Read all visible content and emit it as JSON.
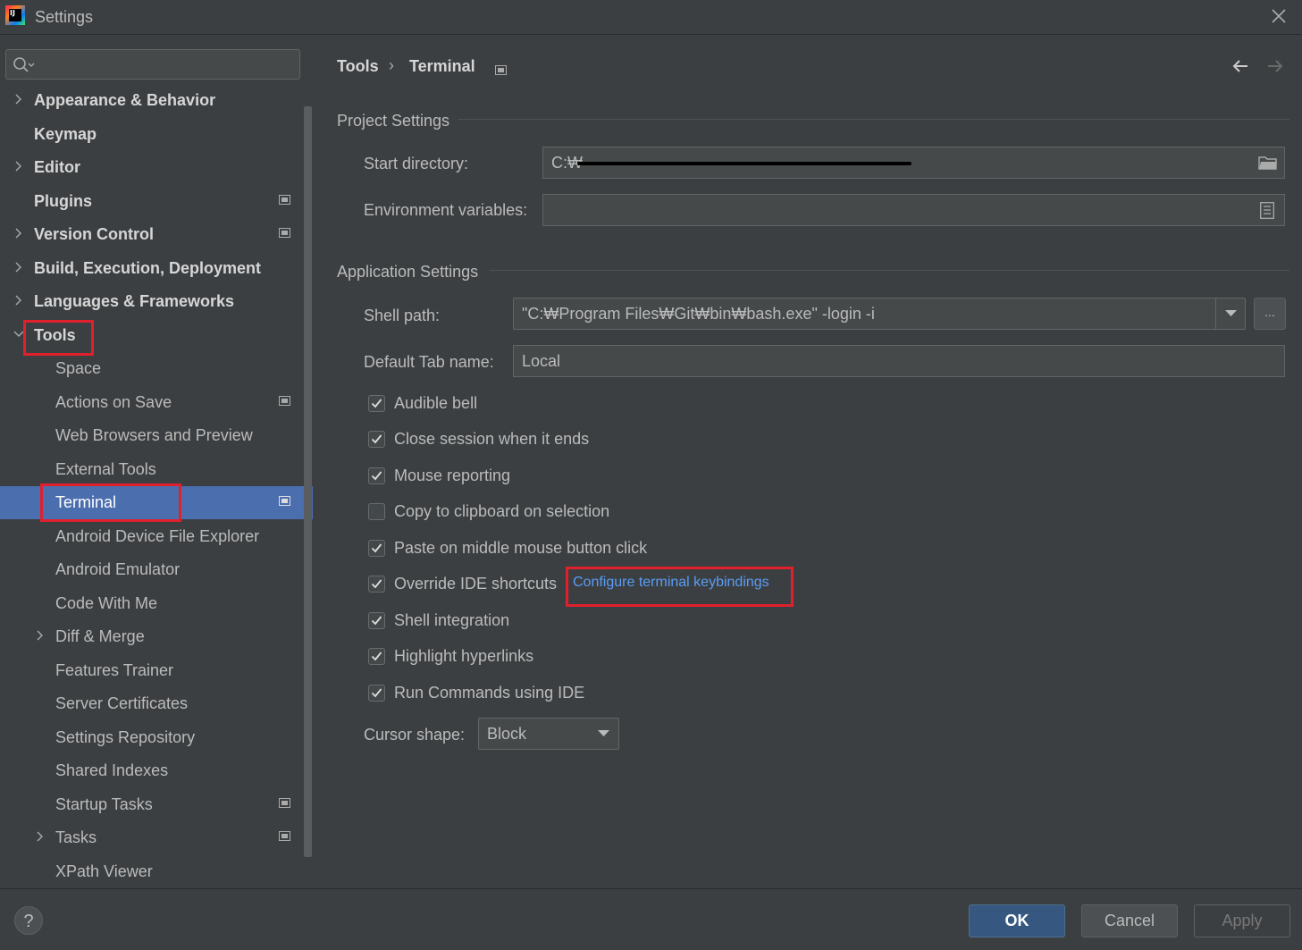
{
  "window": {
    "title": "Settings",
    "logo_text": "IJ"
  },
  "search": {
    "placeholder": ""
  },
  "sidebar": {
    "items": [
      {
        "label": "Appearance & Behavior",
        "level": 0,
        "expandable": true,
        "expanded": false,
        "project_icon": false
      },
      {
        "label": "Keymap",
        "level": 0,
        "expandable": false,
        "project_icon": false
      },
      {
        "label": "Editor",
        "level": 0,
        "expandable": true,
        "expanded": false,
        "project_icon": false
      },
      {
        "label": "Plugins",
        "level": 0,
        "expandable": false,
        "project_icon": true
      },
      {
        "label": "Version Control",
        "level": 0,
        "expandable": true,
        "expanded": false,
        "project_icon": true
      },
      {
        "label": "Build, Execution, Deployment",
        "level": 0,
        "expandable": true,
        "expanded": false,
        "project_icon": false
      },
      {
        "label": "Languages & Frameworks",
        "level": 0,
        "expandable": true,
        "expanded": false,
        "project_icon": false
      },
      {
        "label": "Tools",
        "level": 0,
        "expandable": true,
        "expanded": true,
        "project_icon": false,
        "highlighted": true
      },
      {
        "label": "Space",
        "level": 1,
        "expandable": false,
        "project_icon": false
      },
      {
        "label": "Actions on Save",
        "level": 1,
        "expandable": false,
        "project_icon": true
      },
      {
        "label": "Web Browsers and Preview",
        "level": 1,
        "expandable": false,
        "project_icon": false
      },
      {
        "label": "External Tools",
        "level": 1,
        "expandable": false,
        "project_icon": false
      },
      {
        "label": "Terminal",
        "level": 1,
        "expandable": false,
        "project_icon": true,
        "selected": true,
        "highlighted": true
      },
      {
        "label": "Android Device File Explorer",
        "level": 1,
        "expandable": false,
        "project_icon": false
      },
      {
        "label": "Android Emulator",
        "level": 1,
        "expandable": false,
        "project_icon": false
      },
      {
        "label": "Code With Me",
        "level": 1,
        "expandable": false,
        "project_icon": false
      },
      {
        "label": "Diff & Merge",
        "level": 1,
        "expandable": true,
        "expanded": false,
        "project_icon": false
      },
      {
        "label": "Features Trainer",
        "level": 1,
        "expandable": false,
        "project_icon": false
      },
      {
        "label": "Server Certificates",
        "level": 1,
        "expandable": false,
        "project_icon": false
      },
      {
        "label": "Settings Repository",
        "level": 1,
        "expandable": false,
        "project_icon": false
      },
      {
        "label": "Shared Indexes",
        "level": 1,
        "expandable": false,
        "project_icon": false
      },
      {
        "label": "Startup Tasks",
        "level": 1,
        "expandable": false,
        "project_icon": true
      },
      {
        "label": "Tasks",
        "level": 1,
        "expandable": true,
        "expanded": false,
        "project_icon": true
      },
      {
        "label": "XPath Viewer",
        "level": 1,
        "expandable": false,
        "project_icon": false
      }
    ]
  },
  "breadcrumb": {
    "parent": "Tools",
    "current": "Terminal"
  },
  "project_settings": {
    "title": "Project Settings",
    "start_directory": {
      "label": "Start directory:",
      "value": "C:₩"
    },
    "environment_variables": {
      "label": "Environment variables:",
      "value": ""
    }
  },
  "application_settings": {
    "title": "Application Settings",
    "shell_path": {
      "label": "Shell path:",
      "value": "\"C:₩Program Files₩Git₩bin₩bash.exe\" -login -i",
      "browse_label": "..."
    },
    "default_tab_name": {
      "label": "Default Tab name:",
      "value": "Local"
    },
    "checkboxes": [
      {
        "label": "Audible bell",
        "checked": true
      },
      {
        "label": "Close session when it ends",
        "checked": true
      },
      {
        "label": "Mouse reporting",
        "checked": true
      },
      {
        "label": "Copy to clipboard on selection",
        "checked": false
      },
      {
        "label": "Paste on middle mouse button click",
        "checked": true
      },
      {
        "label": "Override IDE shortcuts",
        "checked": true
      },
      {
        "label": "Shell integration",
        "checked": true
      },
      {
        "label": "Highlight hyperlinks",
        "checked": true
      },
      {
        "label": "Run Commands using IDE",
        "checked": true
      }
    ],
    "keybindings_link": "Configure terminal keybindings",
    "cursor_shape": {
      "label": "Cursor shape:",
      "value": "Block"
    }
  },
  "buttons": {
    "help": "?",
    "ok": "OK",
    "cancel": "Cancel",
    "apply": "Apply"
  },
  "colors": {
    "background": "#3c3f41",
    "selection": "#4b6eaf",
    "link": "#589df6",
    "highlight_box": "#e0202d",
    "ok_button": "#365880"
  }
}
